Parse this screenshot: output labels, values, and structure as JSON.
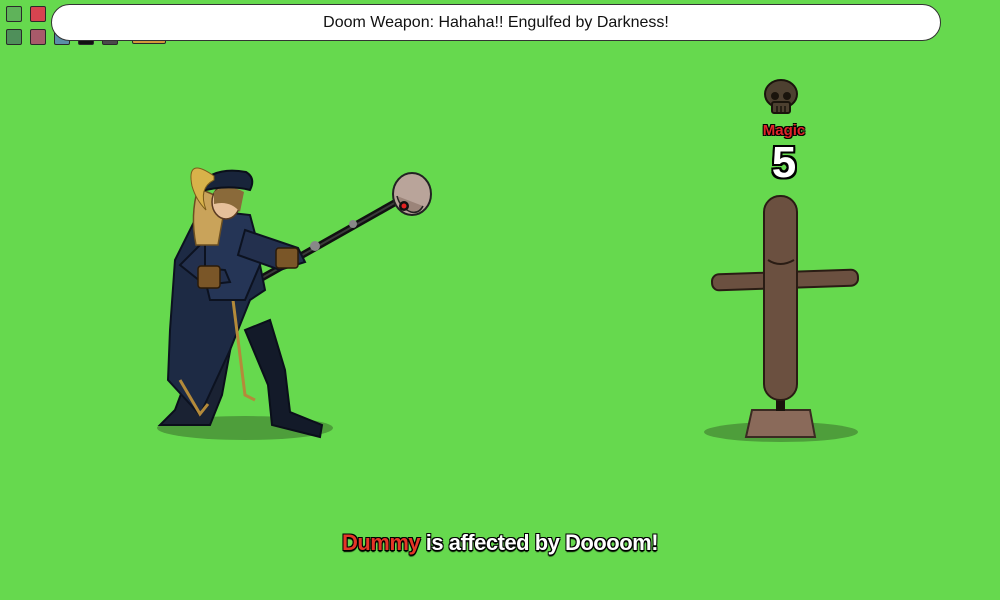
{
  "hud": {
    "swatches": [
      {
        "color": "#5fb35a",
        "label": "green"
      },
      {
        "color": "#d64450",
        "label": "red"
      },
      {
        "color": "#4f8f5a",
        "label": "dark-green"
      },
      {
        "color": "#a85a6a",
        "label": "mauve"
      },
      {
        "color": "#5a8fa8",
        "label": "steel-blue"
      },
      {
        "color": "#111111",
        "label": "black"
      },
      {
        "color": "#4a4a4a",
        "label": "gray"
      },
      {
        "color": "#d39a3a",
        "label": "gold"
      }
    ]
  },
  "dialog": {
    "text": "Doom Weapon: Hahaha!! Engulfed by Darkness!"
  },
  "target": {
    "status_icon": "skull-icon",
    "damage_type": "Magic",
    "damage_value": "5"
  },
  "battle_log": {
    "target_name": "Dummy",
    "message": " is affected by Doooom!"
  },
  "colors": {
    "background": "#66d94e",
    "damage_type": "#e0242a",
    "target_name": "#e53527"
  }
}
